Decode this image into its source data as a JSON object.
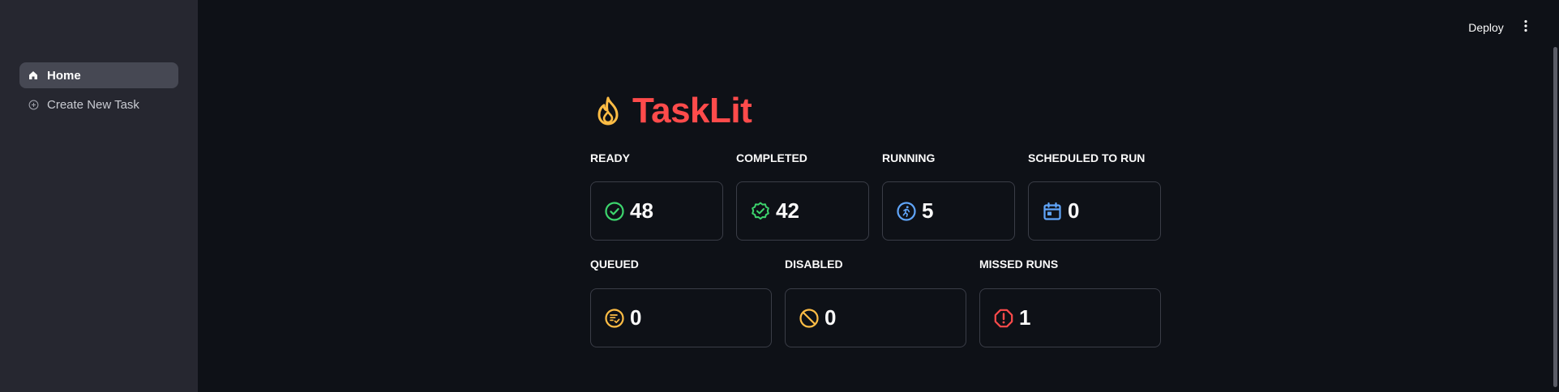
{
  "sidebar": {
    "items": [
      {
        "label": "Home",
        "icon": "home-icon",
        "active": true
      },
      {
        "label": "Create New Task",
        "icon": "add-circle-icon",
        "active": false
      }
    ]
  },
  "header": {
    "deploy_label": "Deploy",
    "menu_icon": "more-vertical-icon"
  },
  "main": {
    "title": "TaskLit",
    "title_icon": "fire-icon",
    "metrics": [
      {
        "label": "READY",
        "value": "48",
        "icon": "check-circle-icon",
        "color": "#3dd56d"
      },
      {
        "label": "COMPLETED",
        "value": "42",
        "icon": "verified-badge-icon",
        "color": "#3dd56d"
      },
      {
        "label": "RUNNING",
        "value": "5",
        "icon": "running-icon",
        "color": "#60a5fa"
      },
      {
        "label": "SCHEDULED TO RUN",
        "value": "0",
        "icon": "calendar-icon",
        "color": "#60a5fa"
      },
      {
        "label": "QUEUED",
        "value": "0",
        "icon": "queue-icon",
        "color": "#ffbd45"
      },
      {
        "label": "DISABLED",
        "value": "0",
        "icon": "block-icon",
        "color": "#ffbd45"
      },
      {
        "label": "MISSED RUNS",
        "value": "1",
        "icon": "error-icon",
        "color": "#ff4b4b"
      }
    ]
  },
  "colors": {
    "accent": "#ff4b4b",
    "background": "#0e1117",
    "sidebar": "#262730"
  }
}
